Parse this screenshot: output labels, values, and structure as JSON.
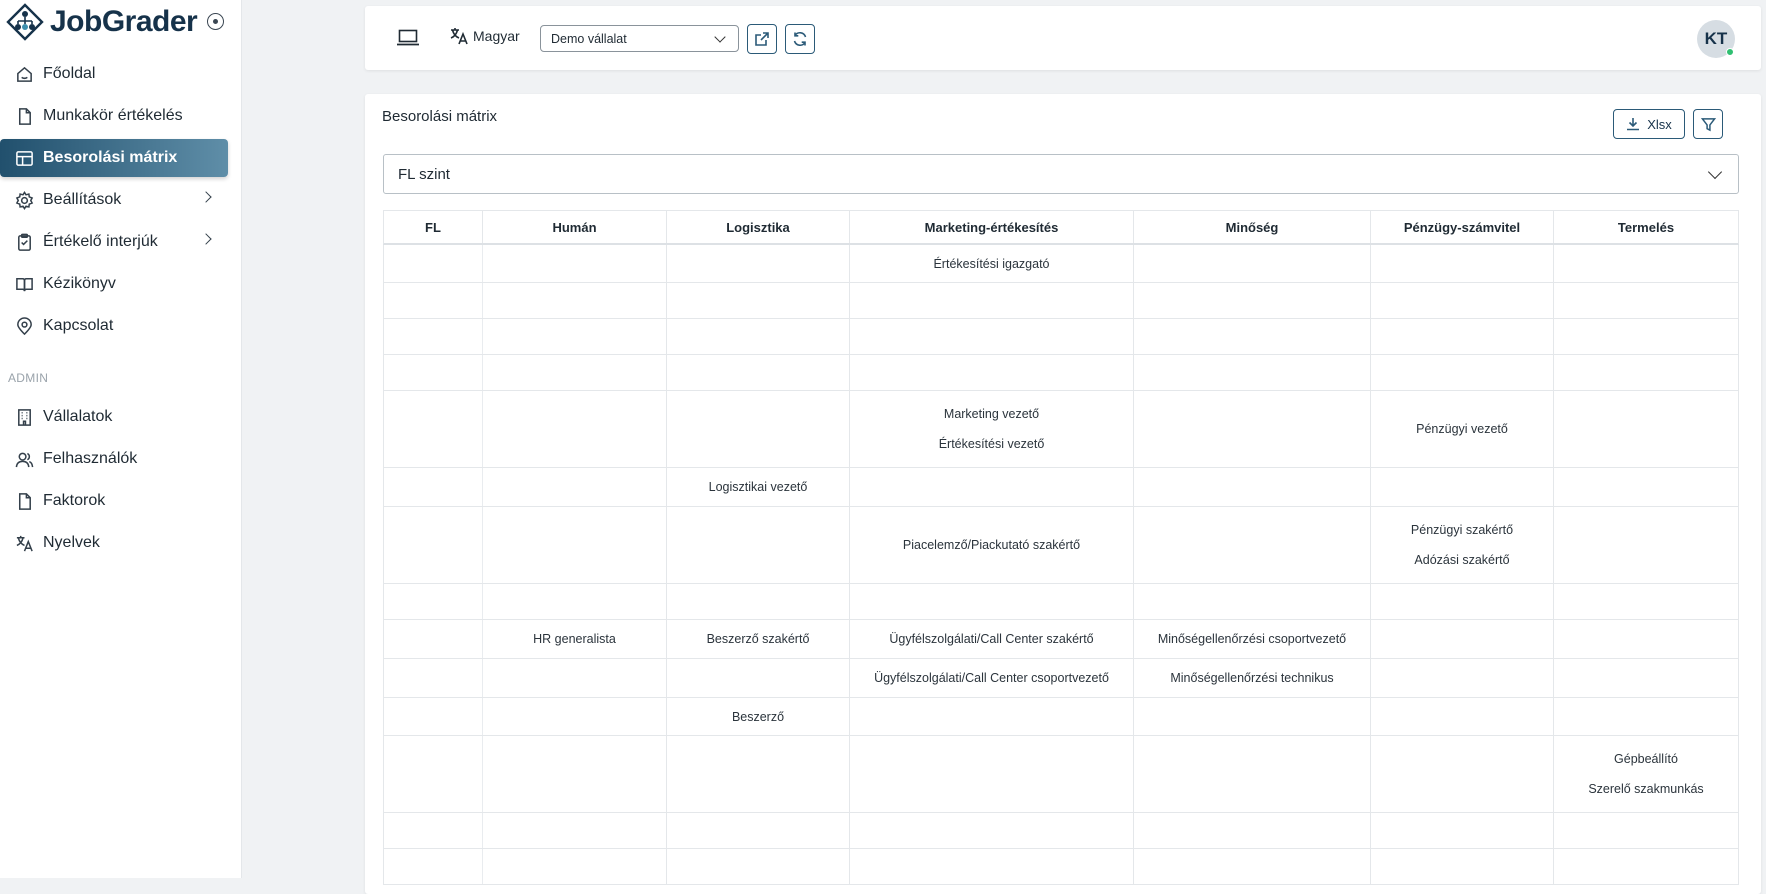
{
  "app": {
    "name": "JobGrader"
  },
  "sidebar": {
    "items": [
      {
        "label": "Főoldal",
        "icon": "home-icon"
      },
      {
        "label": "Munkakör értékelés",
        "icon": "document-icon"
      },
      {
        "label": "Besorolási mátrix",
        "icon": "table-icon",
        "active": true
      },
      {
        "label": "Beállítások",
        "icon": "settings-icon",
        "expandable": true
      },
      {
        "label": "Értékelő interjúk",
        "icon": "clipboard-icon",
        "expandable": true
      },
      {
        "label": "Kézikönyv",
        "icon": "book-icon"
      },
      {
        "label": "Kapcsolat",
        "icon": "location-pin-icon"
      }
    ],
    "admin_label": "ADMIN",
    "admin_items": [
      {
        "label": "Vállalatok",
        "icon": "building-icon"
      },
      {
        "label": "Felhasználók",
        "icon": "users-icon"
      },
      {
        "label": "Faktorok",
        "icon": "document-icon"
      },
      {
        "label": "Nyelvek",
        "icon": "translate-icon"
      }
    ]
  },
  "topbar": {
    "language": "Magyar",
    "company": "Demo vállalat",
    "avatar_initials": "KT"
  },
  "card": {
    "title": "Besorolási mátrix",
    "xlsx_label": "Xlsx",
    "level_select": "FL szint"
  },
  "matrix": {
    "headers": [
      "FL",
      "Humán",
      "Logisztika",
      "Marketing-értékesítés",
      "Minőség",
      "Pénzügy-számvitel",
      "Termelés"
    ],
    "rows": [
      {
        "fl": "",
        "cells": [
          [],
          [],
          [
            "Értékesítési igazgató"
          ],
          [],
          [],
          []
        ]
      },
      {
        "fl": "",
        "cells": [
          [],
          [],
          [],
          [],
          [],
          []
        ]
      },
      {
        "fl": "",
        "cells": [
          [],
          [],
          [],
          [],
          [],
          []
        ]
      },
      {
        "fl": "",
        "cells": [
          [],
          [],
          [],
          [],
          [],
          []
        ]
      },
      {
        "fl": "",
        "cells": [
          [],
          [],
          [
            "Marketing vezető",
            "Értékesítési vezető"
          ],
          [],
          [
            "Pénzügyi vezető"
          ],
          []
        ]
      },
      {
        "fl": "",
        "cells": [
          [],
          [
            "Logisztikai vezető"
          ],
          [],
          [],
          [],
          []
        ]
      },
      {
        "fl": "",
        "cells": [
          [],
          [],
          [
            "Piacelemző/Piackutató szakértő"
          ],
          [],
          [
            "Pénzügyi szakértő",
            "Adózási szakértő"
          ],
          []
        ]
      },
      {
        "fl": "",
        "cells": [
          [],
          [],
          [],
          [],
          [],
          []
        ]
      },
      {
        "fl": "",
        "cells": [
          [
            "HR generalista"
          ],
          [
            "Beszerző szakértő"
          ],
          [
            "Ügyfélszolgálati/Call Center szakértő"
          ],
          [
            "Minőségellenőrzési csoportvezető"
          ],
          [],
          []
        ]
      },
      {
        "fl": "",
        "cells": [
          [],
          [],
          [
            "Ügyfélszolgálati/Call Center csoportvezető"
          ],
          [
            "Minőségellenőrzési technikus"
          ],
          [],
          []
        ]
      },
      {
        "fl": "",
        "cells": [
          [],
          [
            "Beszerző"
          ],
          [],
          [],
          [],
          []
        ]
      },
      {
        "fl": "",
        "cells": [
          [],
          [],
          [],
          [],
          [],
          [
            "Gépbeállító",
            "Szerelő szakmunkás"
          ]
        ]
      },
      {
        "fl": "",
        "cells": [
          [],
          [],
          [],
          [],
          [],
          []
        ]
      },
      {
        "fl": "",
        "cells": [
          [],
          [],
          [],
          [],
          [],
          []
        ]
      }
    ]
  }
}
